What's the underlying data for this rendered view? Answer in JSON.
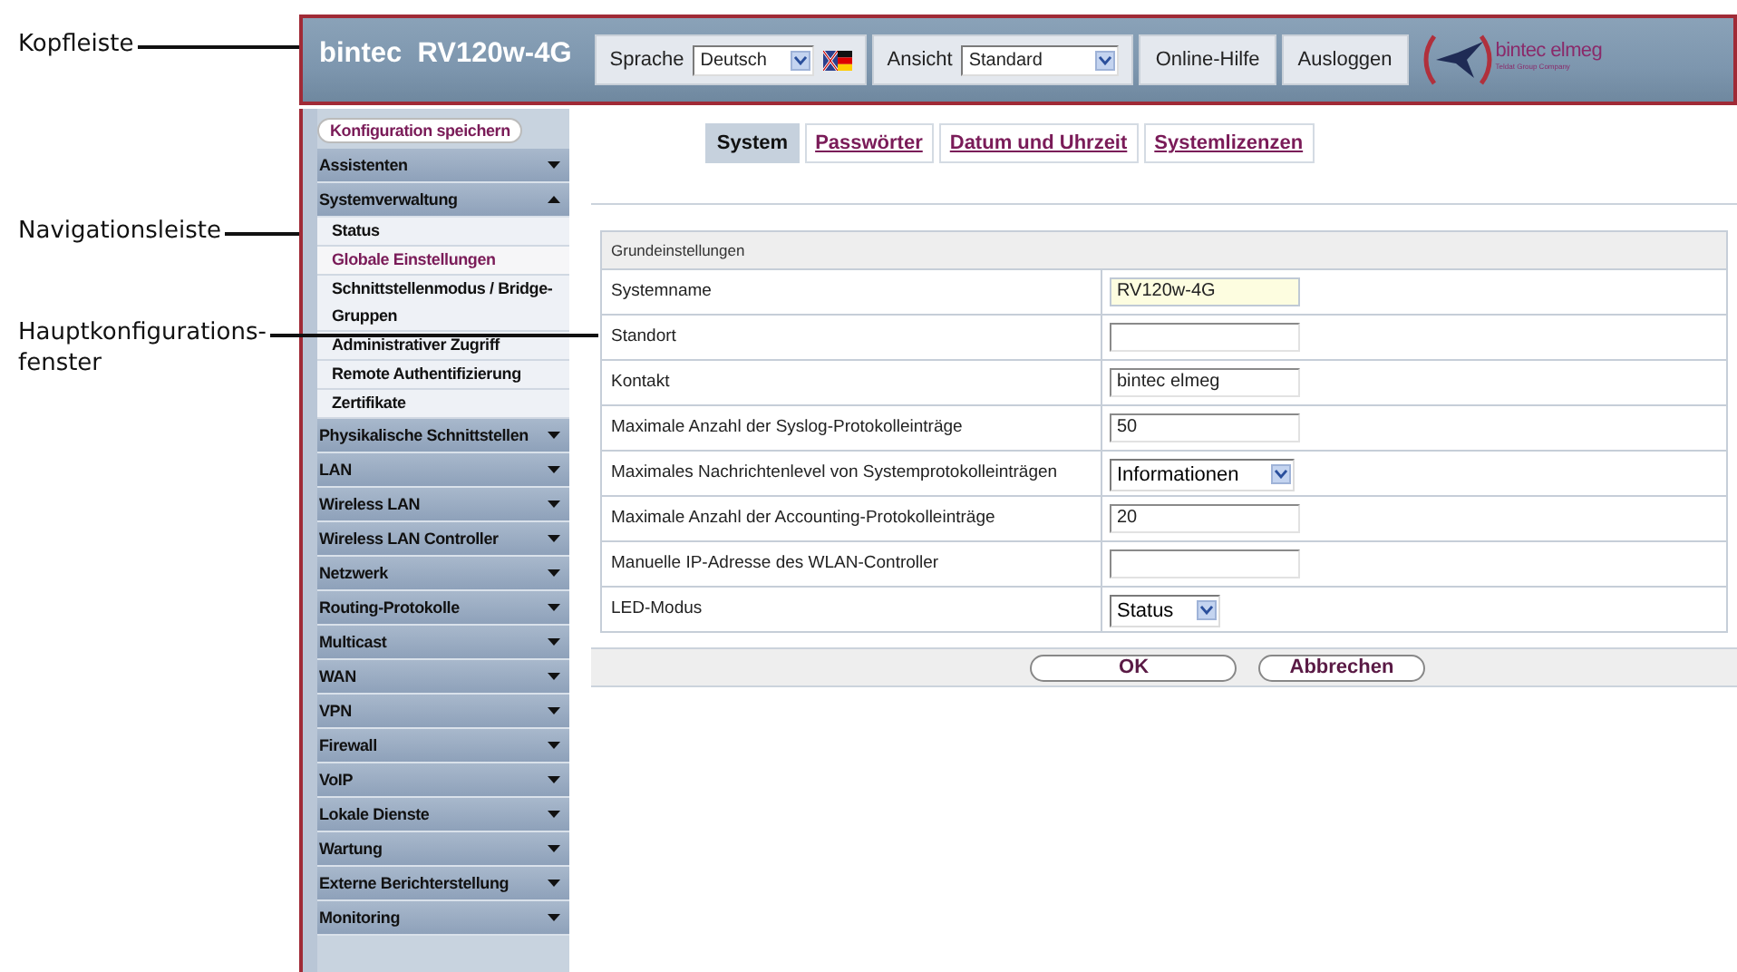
{
  "annotations": [
    {
      "lines": [
        "Kopfleiste"
      ]
    },
    {
      "lines": [
        "Navigationsleiste"
      ]
    },
    {
      "lines": [
        "Hauptkonfigurations-",
        "fenster"
      ]
    }
  ],
  "header": {
    "brand": "bintec  RV120w-4G",
    "language_label": "Sprache",
    "language": "Deutsch",
    "view_label": "Ansicht",
    "view": "Standard",
    "buttons": [
      "Online-Hilfe",
      "Ausloggen"
    ],
    "logo_name": "bintec elmeg",
    "logo_tagline": "Teldat Group Company"
  },
  "sidebar": {
    "save_button": "Konfiguration speichern",
    "items": [
      {
        "label": "Assistenten",
        "expanded": false
      },
      {
        "label": "Systemverwaltung",
        "expanded": true,
        "children": [
          {
            "label": "Status",
            "selected": false
          },
          {
            "label": "Globale Einstellungen",
            "selected": true
          },
          {
            "label": "Schnittstellenmodus / Bridge-Gruppen",
            "selected": false
          },
          {
            "label": "Administrativer Zugriff",
            "selected": false
          },
          {
            "label": "Remote Authentifizierung",
            "selected": false
          },
          {
            "label": "Zertifikate",
            "selected": false
          }
        ]
      },
      {
        "label": "Physikalische Schnittstellen",
        "expanded": false
      },
      {
        "label": "LAN",
        "expanded": false
      },
      {
        "label": "Wireless LAN",
        "expanded": false
      },
      {
        "label": "Wireless LAN Controller",
        "expanded": false
      },
      {
        "label": "Netzwerk",
        "expanded": false
      },
      {
        "label": "Routing-Protokolle",
        "expanded": false
      },
      {
        "label": "Multicast",
        "expanded": false
      },
      {
        "label": "WAN",
        "expanded": false
      },
      {
        "label": "VPN",
        "expanded": false
      },
      {
        "label": "Firewall",
        "expanded": false
      },
      {
        "label": "VoIP",
        "expanded": false
      },
      {
        "label": "Lokale Dienste",
        "expanded": false
      },
      {
        "label": "Wartung",
        "expanded": false
      },
      {
        "label": "Externe Berichterstellung",
        "expanded": false
      },
      {
        "label": "Monitoring",
        "expanded": false
      }
    ]
  },
  "tabs": [
    {
      "label": "System",
      "selected": true
    },
    {
      "label": "Passwörter",
      "selected": false
    },
    {
      "label": "Datum und Uhrzeit",
      "selected": false
    },
    {
      "label": "Systemlizenzen",
      "selected": false
    }
  ],
  "form": {
    "section": "Grundeinstellungen",
    "rows": [
      {
        "label": "Systemname",
        "kind": "text",
        "value": "RV120w-4G",
        "focused": true
      },
      {
        "label": "Standort",
        "kind": "text",
        "focused": false
      },
      {
        "label": "Kontakt",
        "kind": "text",
        "value": "bintec elmeg",
        "focused": false
      },
      {
        "label": "Maximale Anzahl der Syslog-Protokolleinträge",
        "kind": "text",
        "value": "50",
        "focused": false
      },
      {
        "label": "Maximales Nachrichtenlevel von Systemprotokolleinträgen",
        "kind": "select",
        "value": "Informationen",
        "focused": false
      },
      {
        "label": "Maximale Anzahl der Accounting-Protokolleinträge",
        "kind": "text",
        "value": "20",
        "focused": false
      },
      {
        "label": "Manuelle IP-Adresse des WLAN-Controller",
        "kind": "text",
        "focused": false
      },
      {
        "label": "LED-Modus",
        "kind": "select",
        "value": "Status",
        "focused": false
      }
    ],
    "buttons": [
      "OK",
      "Abbrechen"
    ]
  }
}
